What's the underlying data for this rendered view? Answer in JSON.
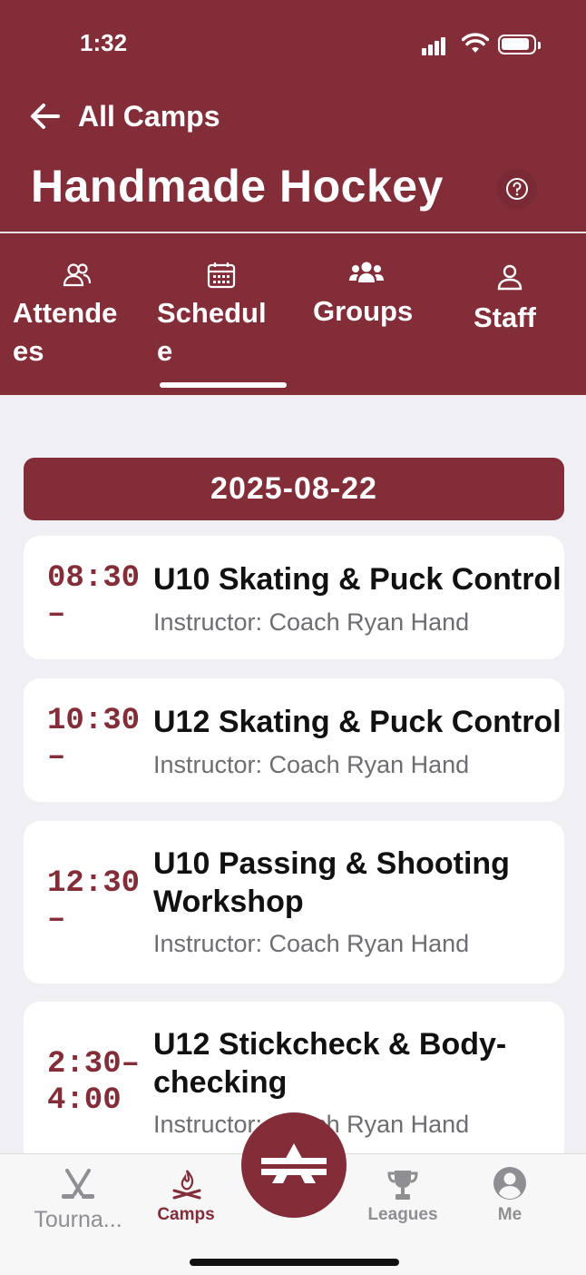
{
  "status_bar": {
    "time": "1:32"
  },
  "nav": {
    "back_label": "All Camps"
  },
  "camp": {
    "title": "Handmade Hockey"
  },
  "tabs": [
    {
      "label_line1": "Attende",
      "label_line2": "es",
      "icon": "people-outline-icon"
    },
    {
      "label_line1": "Schedul",
      "label_line2": "e",
      "icon": "calendar-icon",
      "active": true
    },
    {
      "label": "Groups",
      "icon": "group-icon"
    },
    {
      "label": "Staff",
      "icon": "person-outline-icon"
    }
  ],
  "schedule": {
    "date": "2025-08-22",
    "items": [
      {
        "time_line1": "08:30",
        "time_line2": "–",
        "title": "U10 Skating & Puck Control",
        "instructor": "Instructor: Coach Ryan Hand"
      },
      {
        "time_line1": "10:30",
        "time_line2": "–",
        "title": "U12 Skating & Puck Control",
        "instructor": "Instructor: Coach Ryan Hand"
      },
      {
        "time_line1": "12:30",
        "time_line2": "–",
        "title": "U10 Passing & Shooting Workshop",
        "instructor": "Instructor: Coach Ryan Hand"
      },
      {
        "time_line1": "2:30–",
        "time_line2": "4:00",
        "title": "U12 Stickcheck & Body-checking",
        "instructor": "Instructor: Coach Ryan Hand"
      }
    ]
  },
  "tabbar": {
    "items": [
      {
        "label": "Tourna...",
        "icon": "hockey-sticks-icon"
      },
      {
        "label": "Camps",
        "icon": "campfire-icon",
        "active": true
      },
      {
        "label": "Leagues",
        "icon": "trophy-icon"
      },
      {
        "label": "Me",
        "icon": "user-circle-icon"
      }
    ]
  },
  "colors": {
    "brand": "#822d38",
    "background": "#efeff4",
    "muted": "#6d6d72"
  }
}
